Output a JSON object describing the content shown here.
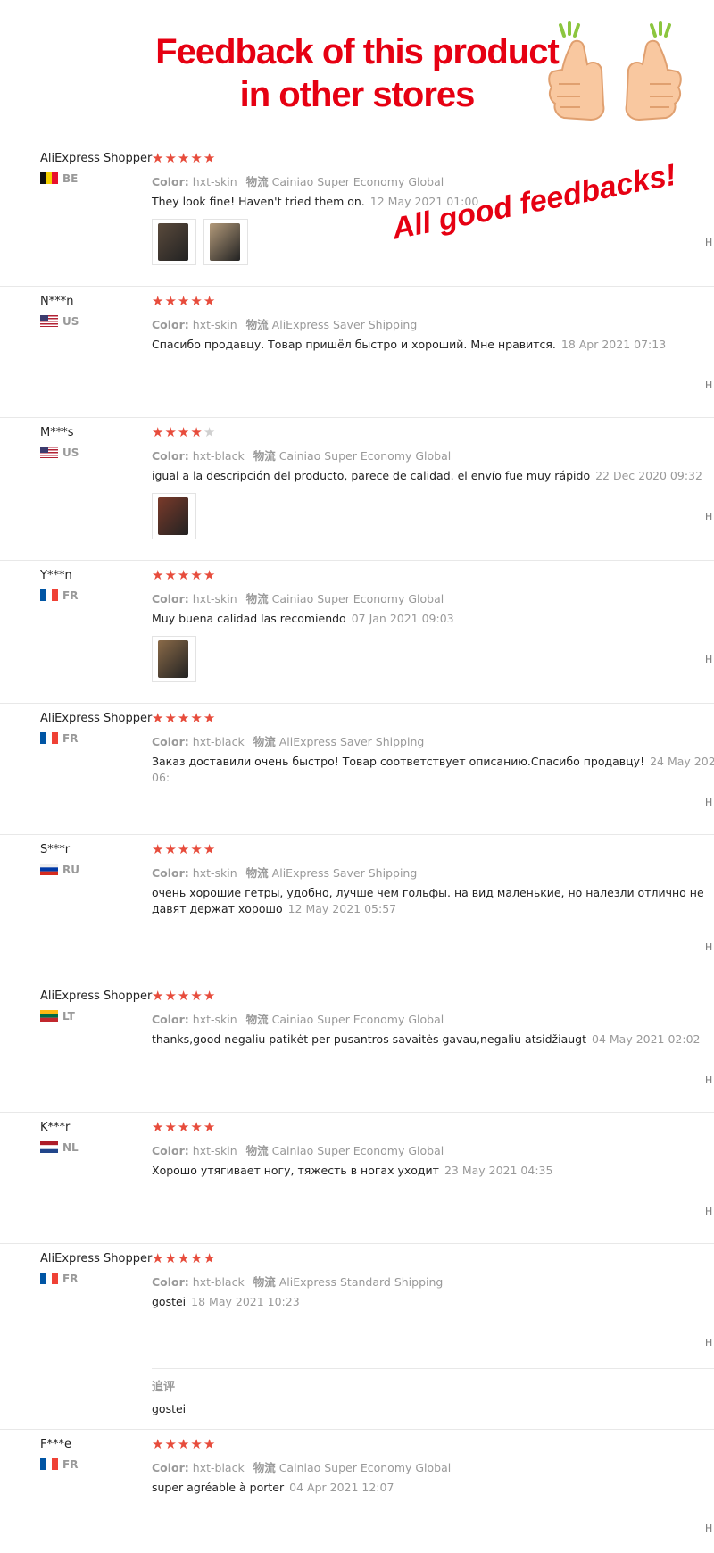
{
  "header": {
    "title_line1": "Feedback of this product",
    "title_line2": "in other stores",
    "banner": "All good feedbacks!",
    "thumb_icon": "thumbs-up-icon"
  },
  "colors": {
    "title": "#e60012",
    "star_on": "#e74c3c",
    "star_off": "#d0d0d0",
    "muted": "#999999"
  },
  "labels": {
    "color": "Color:",
    "shipping": "物流",
    "followup": "追评"
  },
  "reviews": [
    {
      "user": "AliExpress Shopper",
      "country": "BE",
      "stars": 5,
      "color": "hxt-skin",
      "shipping": "Cainiao Super Economy Global",
      "text": "They look fine! Haven't tried them on.",
      "date": "12 May 2021 01:00",
      "photos": 2
    },
    {
      "user": "N***n",
      "country": "US",
      "stars": 5,
      "color": "hxt-skin",
      "shipping": "AliExpress Saver Shipping",
      "text": "Спасибо продавцу. Товар пришёл быстро и хороший. Мне нравится.",
      "date": "18 Apr 2021 07:13",
      "photos": 0
    },
    {
      "user": "M***s",
      "country": "US",
      "stars": 4,
      "color": "hxt-black",
      "shipping": "Cainiao Super Economy Global",
      "text": "igual a la descripción del producto, parece de calidad. el envío fue muy rápido",
      "date": "22 Dec 2020 09:32",
      "photos": 1
    },
    {
      "user": "Y***n",
      "country": "FR",
      "stars": 5,
      "color": "hxt-skin",
      "shipping": "Cainiao Super Economy Global",
      "text": "Muy buena calidad las recomiendo",
      "date": "07 Jan 2021 09:03",
      "photos": 1
    },
    {
      "user": "AliExpress Shopper",
      "country": "FR",
      "stars": 5,
      "color": "hxt-black",
      "shipping": "AliExpress Saver Shipping",
      "text": "Заказ доставили очень быстро! Товар соответствует описанию.Спасибо продавцу!",
      "date": "24 May 2021 06:",
      "photos": 0
    },
    {
      "user": "S***r",
      "country": "RU",
      "stars": 5,
      "color": "hxt-skin",
      "shipping": "AliExpress Saver Shipping",
      "text": "очень хорошие гетры, удобно, лучше чем гольфы. на вид маленькие, но налезли отлично не давят держат хорошо",
      "date": "12 May 2021 05:57",
      "photos": 0
    },
    {
      "user": "AliExpress Shopper",
      "country": "LT",
      "stars": 5,
      "color": "hxt-skin",
      "shipping": "Cainiao Super Economy Global",
      "text": "thanks,good negaliu patikėt per pusantros savaitės gavau,negaliu atsidžiaugt",
      "date": "04 May 2021 02:02",
      "photos": 0
    },
    {
      "user": "K***r",
      "country": "NL",
      "stars": 5,
      "color": "hxt-skin",
      "shipping": "Cainiao Super Economy Global",
      "text": "Хорошо утягивает ногу, тяжесть в ногах уходит",
      "date": "23 May 2021 04:35",
      "photos": 0
    },
    {
      "user": "AliExpress Shopper",
      "country": "FR",
      "stars": 5,
      "color": "hxt-black",
      "shipping": "AliExpress Standard Shipping",
      "text": "gostei",
      "date": "18 May 2021 10:23",
      "photos": 0,
      "followup": "gostei"
    },
    {
      "user": "F***e",
      "country": "FR",
      "stars": 5,
      "color": "hxt-black",
      "shipping": "Cainiao Super Economy Global",
      "text": "super agréable à porter",
      "date": "04 Apr 2021 12:07",
      "photos": 0
    }
  ]
}
